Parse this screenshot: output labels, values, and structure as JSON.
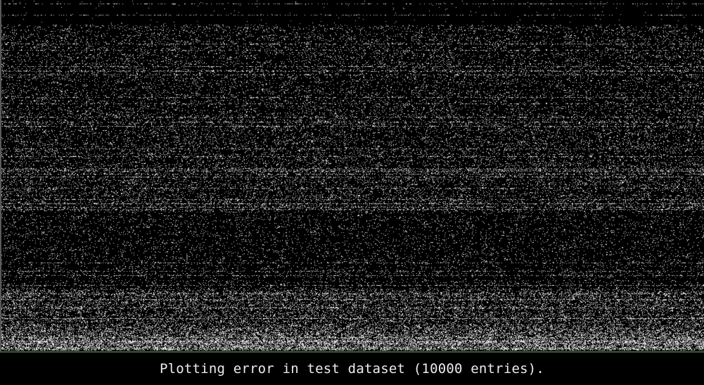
{
  "status": {
    "message": "Plotting error in test dataset (10000 entries)."
  },
  "plot": {
    "entries": 10000,
    "dot_color": "#ffffff",
    "background_color": "#000000"
  }
}
